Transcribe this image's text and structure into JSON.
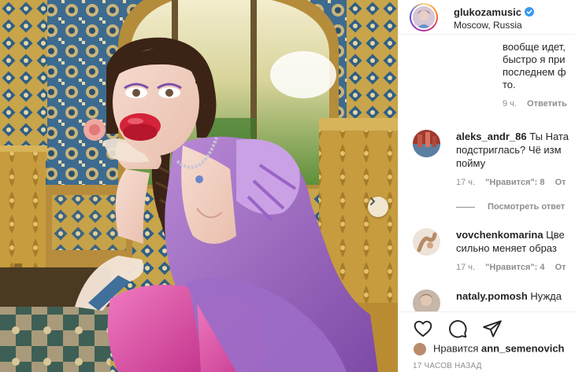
{
  "post": {
    "username": "glukozamusic",
    "location": "Moscow, Russia",
    "verified": true
  },
  "caption": {
    "lines": [
      "вообще идет,",
      "быстро я при",
      "последнем ф",
      "то."
    ],
    "time": "9 ч.",
    "reply_label": "Ответить"
  },
  "comments": [
    {
      "username": "aleks_andr_86",
      "text_first": "Ты Ната",
      "text_lines": [
        "подстриглась? Чё изм",
        "пойму"
      ],
      "time": "17 ч.",
      "likes": "\"Нравится\": 8",
      "reply_label": "От",
      "view_replies": "Посмотреть ответ",
      "avatar_color": "#a0392e"
    },
    {
      "username": "vovchenkomarina",
      "text_first": "Цве",
      "text_lines": [
        "сильно меняет образ"
      ],
      "time": "17 ч.",
      "likes": "\"Нравится\": 4",
      "reply_label": "От",
      "avatar_color": "#d8c2ad"
    },
    {
      "username": "nataly.pomosh",
      "text_first": "Нужда",
      "text_lines": [],
      "avatar_color": "#c7b7a9"
    }
  ],
  "likes_row": {
    "prefix": "Нравится",
    "user": "ann_semenovich"
  },
  "timestamp": "17 ЧАСОВ НАЗАД",
  "icons": [
    "heart-icon",
    "comment-icon",
    "share-icon",
    "verified-icon",
    "chevron-right-icon"
  ],
  "colors": {
    "verified": "#3897f0",
    "muted_text": "#8e8e8e",
    "text": "#262626"
  }
}
